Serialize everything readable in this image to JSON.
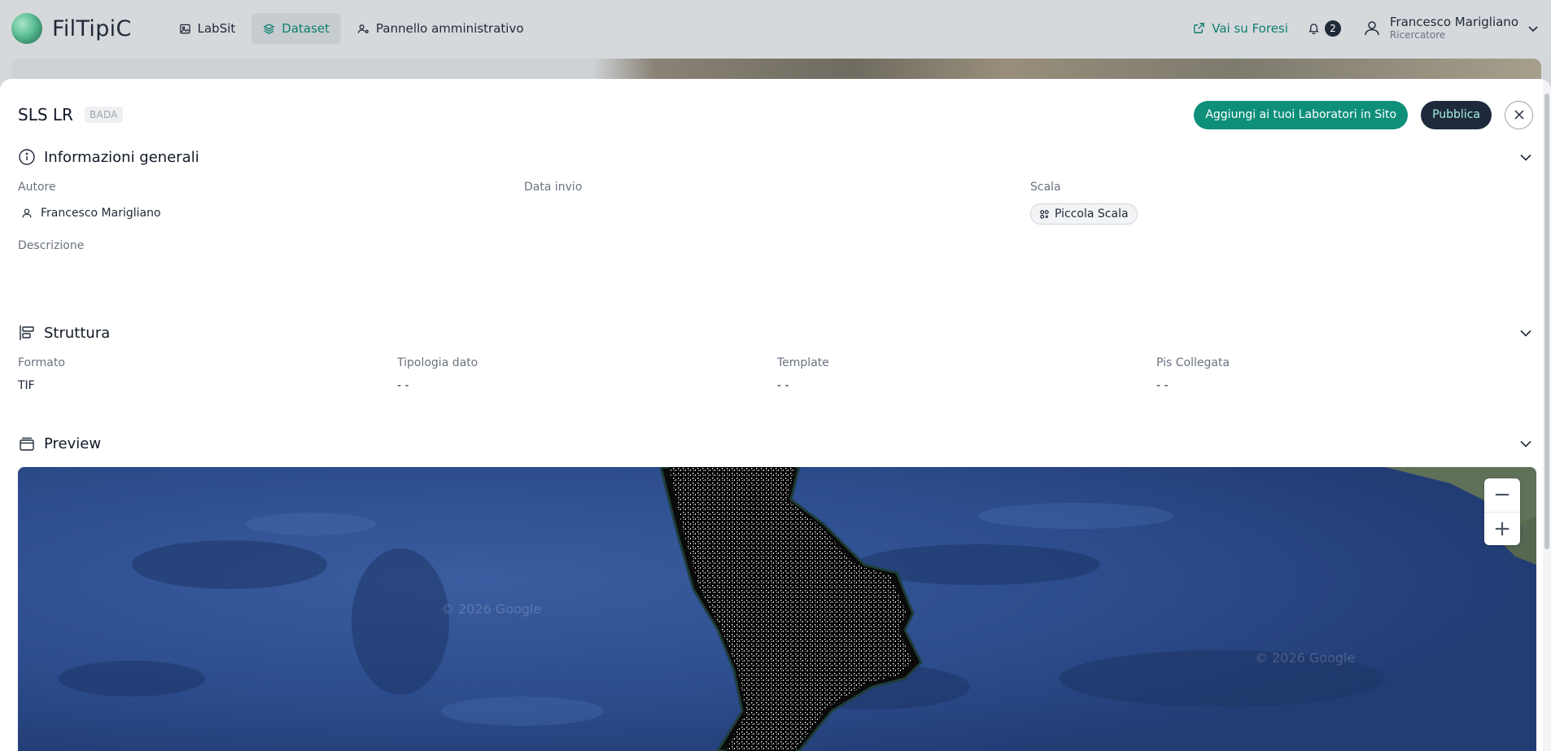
{
  "app": {
    "name": "FilTipiC"
  },
  "nav": {
    "items": [
      {
        "label": "LabSit",
        "active": false
      },
      {
        "label": "Dataset",
        "active": true
      },
      {
        "label": "Pannello amministrativo",
        "active": false
      }
    ]
  },
  "topbar": {
    "external_link": "Vai su Foresi",
    "notifications_count": "2",
    "user_name": "Francesco Marigliano",
    "user_role": "Ricercatore"
  },
  "header": {
    "title": "SLS LR",
    "tag": "BADA",
    "add_button": "Aggiungi ai tuoi Laboratori in Sito",
    "publish_button": "Pubblica"
  },
  "general_info": {
    "title": "Informazioni generali",
    "author_label": "Autore",
    "author_value": "Francesco Marigliano",
    "date_label": "Data invio",
    "scale_label": "Scala",
    "scale_value": "Piccola Scala",
    "description_label": "Descrizione"
  },
  "structure": {
    "title": "Struttura",
    "fields": [
      {
        "label": "Formato",
        "value": "TIF"
      },
      {
        "label": "Tipologia dato",
        "value": "- -"
      },
      {
        "label": "Template",
        "value": "- -"
      },
      {
        "label": "Pis Collegata",
        "value": "- -"
      }
    ]
  },
  "preview": {
    "title": "Preview",
    "watermark": "© 2026 Google"
  },
  "colors": {
    "accent": "#0e8f7a",
    "dark": "#1e2a3b",
    "sea": "#2b4a86"
  }
}
